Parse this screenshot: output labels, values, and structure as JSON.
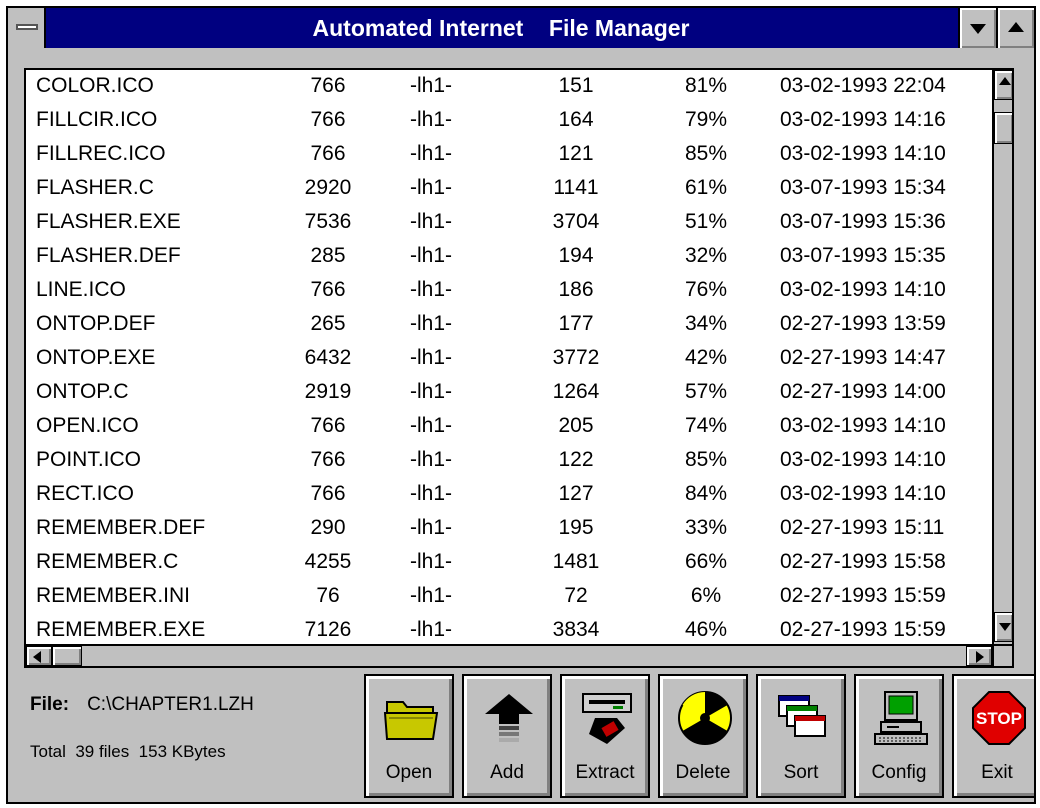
{
  "window": {
    "title": "Automated Internet    File Manager"
  },
  "files": [
    {
      "name": "COLOR.ICO",
      "size": "766",
      "method": "-lh1-",
      "compressed": "151",
      "ratio": "81%",
      "date": "03-02-1993 22:04"
    },
    {
      "name": "FILLCIR.ICO",
      "size": "766",
      "method": "-lh1-",
      "compressed": "164",
      "ratio": "79%",
      "date": "03-02-1993 14:16"
    },
    {
      "name": "FILLREC.ICO",
      "size": "766",
      "method": "-lh1-",
      "compressed": "121",
      "ratio": "85%",
      "date": "03-02-1993 14:10"
    },
    {
      "name": "FLASHER.C",
      "size": "2920",
      "method": "-lh1-",
      "compressed": "1141",
      "ratio": "61%",
      "date": "03-07-1993 15:34"
    },
    {
      "name": "FLASHER.EXE",
      "size": "7536",
      "method": "-lh1-",
      "compressed": "3704",
      "ratio": "51%",
      "date": "03-07-1993 15:36"
    },
    {
      "name": "FLASHER.DEF",
      "size": "285",
      "method": "-lh1-",
      "compressed": "194",
      "ratio": "32%",
      "date": "03-07-1993 15:35"
    },
    {
      "name": "LINE.ICO",
      "size": "766",
      "method": "-lh1-",
      "compressed": "186",
      "ratio": "76%",
      "date": "03-02-1993 14:10"
    },
    {
      "name": "ONTOP.DEF",
      "size": "265",
      "method": "-lh1-",
      "compressed": "177",
      "ratio": "34%",
      "date": "02-27-1993 13:59"
    },
    {
      "name": "ONTOP.EXE",
      "size": "6432",
      "method": "-lh1-",
      "compressed": "3772",
      "ratio": "42%",
      "date": "02-27-1993 14:47"
    },
    {
      "name": "ONTOP.C",
      "size": "2919",
      "method": "-lh1-",
      "compressed": "1264",
      "ratio": "57%",
      "date": "02-27-1993 14:00"
    },
    {
      "name": "OPEN.ICO",
      "size": "766",
      "method": "-lh1-",
      "compressed": "205",
      "ratio": "74%",
      "date": "03-02-1993 14:10"
    },
    {
      "name": "POINT.ICO",
      "size": "766",
      "method": "-lh1-",
      "compressed": "122",
      "ratio": "85%",
      "date": "03-02-1993 14:10"
    },
    {
      "name": "RECT.ICO",
      "size": "766",
      "method": "-lh1-",
      "compressed": "127",
      "ratio": "84%",
      "date": "03-02-1993 14:10"
    },
    {
      "name": "REMEMBER.DEF",
      "size": "290",
      "method": "-lh1-",
      "compressed": "195",
      "ratio": "33%",
      "date": "02-27-1993 15:11"
    },
    {
      "name": "REMEMBER.C",
      "size": "4255",
      "method": "-lh1-",
      "compressed": "1481",
      "ratio": "66%",
      "date": "02-27-1993 15:58"
    },
    {
      "name": "REMEMBER.INI",
      "size": "76",
      "method": "-lh1-",
      "compressed": "72",
      "ratio": "6%",
      "date": "02-27-1993 15:59"
    },
    {
      "name": "REMEMBER.EXE",
      "size": "7126",
      "method": "-lh1-",
      "compressed": "3834",
      "ratio": "46%",
      "date": "02-27-1993 15:59"
    }
  ],
  "status": {
    "file_label": "File:",
    "file_path": "C:\\CHAPTER1.LZH",
    "totals": "Total  39 files  153 KBytes"
  },
  "toolbar": {
    "open": "Open",
    "add": "Add",
    "extract": "Extract",
    "delete": "Delete",
    "sort": "Sort",
    "config": "Config",
    "exit": "Exit",
    "stop_sign_text": "STOP"
  },
  "colors": {
    "titlebar": "#000080",
    "face": "#c0c0c0",
    "stop_red": "#e00000",
    "folder_yellow": "#c8c800",
    "radiation_yellow": "#ffff00"
  }
}
